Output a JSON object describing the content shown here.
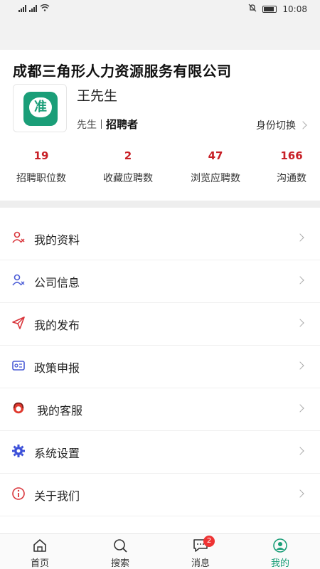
{
  "status_bar": {
    "time": "10:08"
  },
  "header": {
    "company": "成都三角形人力资源服务有限公司"
  },
  "profile": {
    "logo_char": "准",
    "name": "王先生",
    "title": "先生",
    "role": "招聘者",
    "switch_label": "身份切换"
  },
  "stats": [
    {
      "value": "19",
      "label": "招聘职位数"
    },
    {
      "value": "2",
      "label": "收藏应聘数"
    },
    {
      "value": "47",
      "label": "浏览应聘数"
    },
    {
      "value": "166",
      "label": "沟通数"
    }
  ],
  "menu": [
    {
      "label": "我的资料",
      "icon": "profile-icon"
    },
    {
      "label": "公司信息",
      "icon": "company-icon"
    },
    {
      "label": "我的发布",
      "icon": "send-icon"
    },
    {
      "label": "政策申报",
      "icon": "policy-icon"
    },
    {
      "label": "我的客服",
      "icon": "support-icon"
    },
    {
      "label": "系统设置",
      "icon": "gear-icon"
    },
    {
      "label": "关于我们",
      "icon": "info-icon"
    }
  ],
  "tabbar": {
    "home": "首页",
    "search": "搜索",
    "messages": "消息",
    "messages_badge": "2",
    "mine": "我的"
  },
  "colors": {
    "accent_red": "#c82027",
    "brand_green": "#1a9e78"
  }
}
